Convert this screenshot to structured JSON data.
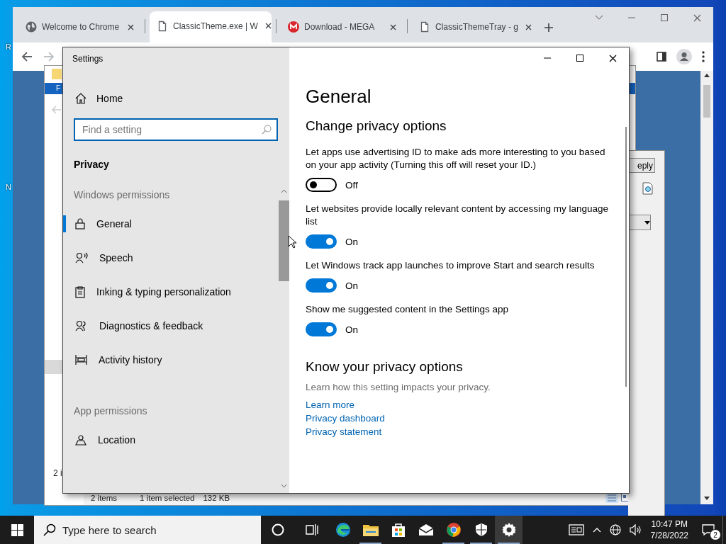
{
  "desktop": {
    "icon_labels": [
      "R",
      "N"
    ]
  },
  "browser": {
    "tabs": [
      {
        "title": "Welcome to Chrome",
        "kind": "globe",
        "selected": false
      },
      {
        "title": "ClassicTheme.exe | W",
        "kind": "page",
        "selected": true
      },
      {
        "title": "Download - MEGA",
        "kind": "mega",
        "selected": false
      },
      {
        "title": "ClassicThemeTray - g",
        "kind": "page",
        "selected": false
      }
    ]
  },
  "explorer": {
    "ribbon_tab": "F",
    "item_count_fragment": "2 i",
    "dialog_button": "eply",
    "status_bar": [
      "2 items",
      "1 item selected",
      "132 KB"
    ]
  },
  "settings": {
    "title": "Settings",
    "home": "Home",
    "search": {
      "placeholder": "Find a setting"
    },
    "category": "Privacy",
    "groups": [
      {
        "heading": "Windows permissions",
        "items": [
          {
            "label": "General",
            "kind": "lock",
            "selected": true
          },
          {
            "label": "Speech",
            "kind": "speech",
            "selected": false
          },
          {
            "label": "Inking & typing personalization",
            "kind": "clipboard",
            "selected": false
          },
          {
            "label": "Diagnostics & feedback",
            "kind": "people",
            "selected": false
          },
          {
            "label": "Activity history",
            "kind": "timeline",
            "selected": false
          }
        ]
      },
      {
        "heading": "App permissions",
        "items": [
          {
            "label": "Location",
            "kind": "location",
            "selected": false
          }
        ]
      }
    ],
    "page_title": "General",
    "section_title": "Change privacy options",
    "options": [
      {
        "description": "Let apps use advertising ID to make ads more interesting to you based on your app activity (Turning this off will reset your ID.)",
        "on": false,
        "state_label": "Off"
      },
      {
        "description": "Let websites provide locally relevant content by accessing my language list",
        "on": true,
        "state_label": "On"
      },
      {
        "description": "Let Windows track app launches to improve Start and search results",
        "on": true,
        "state_label": "On"
      },
      {
        "description": "Show me suggested content in the Settings app",
        "on": true,
        "state_label": "On"
      }
    ],
    "know": {
      "heading": "Know your privacy options",
      "text": "Learn how this setting impacts your privacy.",
      "links": [
        "Learn more",
        "Privacy dashboard",
        "Privacy statement"
      ]
    }
  },
  "taskbar": {
    "search": {
      "placeholder": "Type here to search"
    },
    "apps": [
      {
        "kind": "cortana",
        "running": false,
        "active": false
      },
      {
        "kind": "taskview",
        "running": false,
        "active": false
      },
      {
        "kind": "edge",
        "running": false,
        "active": false
      },
      {
        "kind": "folder",
        "running": true,
        "active": false
      },
      {
        "kind": "store",
        "running": false,
        "active": false
      },
      {
        "kind": "mail",
        "running": false,
        "active": false
      },
      {
        "kind": "chrome",
        "running": true,
        "active": false
      },
      {
        "kind": "shield",
        "running": true,
        "active": false
      },
      {
        "kind": "gear",
        "running": true,
        "active": true
      }
    ],
    "time": "10:47 PM",
    "date": "7/28/2022",
    "notification_count": "2"
  }
}
